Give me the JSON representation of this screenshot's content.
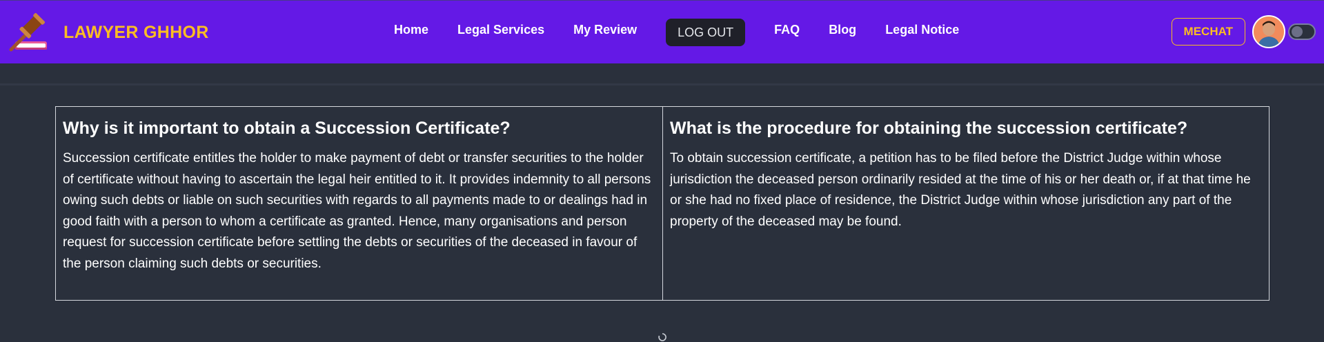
{
  "brand": {
    "name": "LAWYER GHHOR",
    "logo_icon": "gavel-book-icon"
  },
  "nav": {
    "links": [
      "Home",
      "Legal Services",
      "My Review"
    ],
    "logout_label": "LOG OUT",
    "links_after": [
      "FAQ",
      "Blog",
      "Legal Notice"
    ]
  },
  "tools": {
    "mechat_label": "MECHAT",
    "avatar_icon": "user-avatar",
    "theme_toggle_icon": "theme-toggle"
  },
  "faq": [
    {
      "question": "Why is it important to obtain a Succession Certificate?",
      "answer": "Succession certificate entitles the holder to make payment of debt or transfer securities to the holder of certificate without having to ascertain the legal heir entitled to it. It provides indemnity to all persons owing such debts or liable on such securities with regards to all payments made to or dealings had in good faith with a person to whom a certificate as granted. Hence, many organisations and person request for succession certificate before settling the debts or securities of the deceased in favour of the person claiming such debts or securities."
    },
    {
      "question": "What is the procedure for obtaining the succession certificate?",
      "answer": "To obtain succession certificate, a petition has to be filed before the District Judge within whose jurisdiction the deceased person ordinarily resided at the time of his or her death or, if at that time he or she had no fixed place of residence, the District Judge within whose jurisdiction any part of the property of the deceased may be found."
    }
  ],
  "colors": {
    "navbar": "#6419e6",
    "accent": "#fbbd23",
    "background": "#2a303c",
    "logout_button": "#1f2029"
  }
}
